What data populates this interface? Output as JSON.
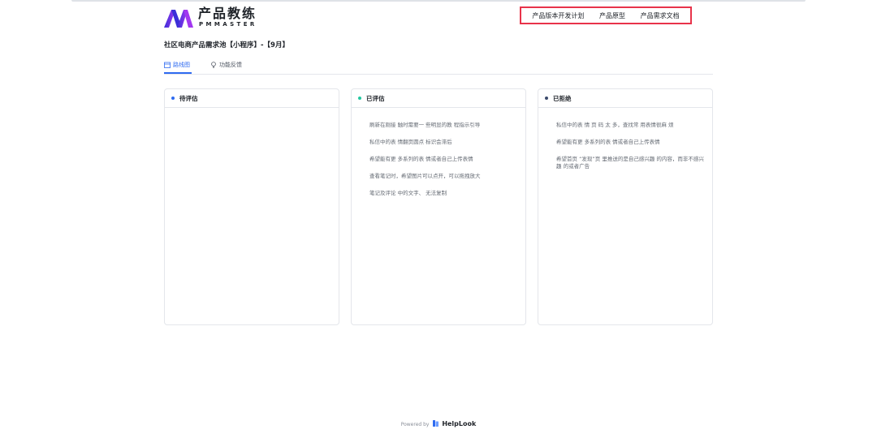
{
  "logo": {
    "title": "产品教练",
    "subtitle": "PMMASTER",
    "colors": [
      "#3a2fd8",
      "#a237f0"
    ]
  },
  "top_nav": {
    "items": [
      "产品版本开发计划",
      "产品原型",
      "产品需求文档"
    ],
    "highlight_color": "#e8334a"
  },
  "page": {
    "title": "社区电商产品需求池【小程序】-【9月】"
  },
  "tabs": {
    "active": {
      "label": "路线图",
      "icon": "calendar-icon"
    },
    "inactive": {
      "label": "功能反馈",
      "icon": "lightbulb-icon"
    }
  },
  "columns": [
    {
      "title": "待评估",
      "dot_color": "#2f6bf0",
      "items": []
    },
    {
      "title": "已评估",
      "dot_color": "#22c7a0",
      "items": [
        "刷新在刚接 触时需要一 些明显的教 程指示引导",
        "私信中的表 情翻页圆点 标识会滞后",
        "希望能有更 多系列的表 情或者自己上传表情",
        "查看笔记时，希望图片可以点开，可以拖拽放大",
        "笔记及评论 中的文字、 无法复制"
      ]
    },
    {
      "title": "已拒绝",
      "dot_color": "#3a4a6b",
      "items": [
        "私信中的表 情 页 码 太 多，查找常 用表情很麻 烦",
        "希望能有更 多系列的表 情或者自己上传表情",
        "希望首页 “发现”页 里推送的是自己感兴趣 的内容，而非不感兴趣 的或者广告"
      ]
    }
  ],
  "footer": {
    "prefix": "Powered by",
    "brand": "HelpLook",
    "brand_color": "#2f6bf0"
  }
}
